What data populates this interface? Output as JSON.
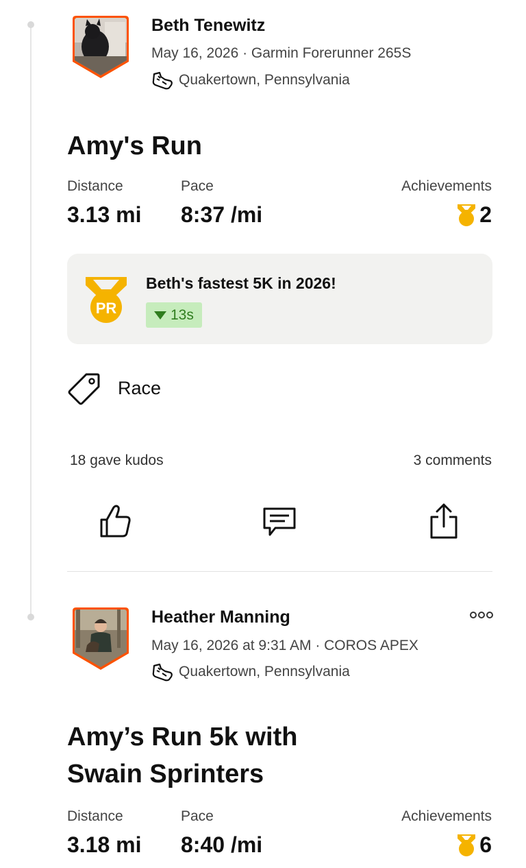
{
  "feed": {
    "activities": [
      {
        "athlete": "Beth Tenewitz",
        "meta": "May 16, 2026 · Garmin Forerunner 265S",
        "location": "Quakertown, Pennsylvania",
        "title": "Amy's Run",
        "stats": {
          "distance_label": "Distance",
          "distance_value": "3.13 mi",
          "pace_label": "Pace",
          "pace_value": "8:37 /mi",
          "achievements_label": "Achievements",
          "achievements_count": "2"
        },
        "pr": {
          "badge": "PR",
          "text": "Beth's fastest 5K in 2026!",
          "delta": "13s"
        },
        "tag": "Race",
        "kudos": "18 gave kudos",
        "comments": "3 comments"
      },
      {
        "athlete": "Heather Manning",
        "meta": "May 16, 2026 at 9:31 AM · COROS APEX",
        "location": "Quakertown, Pennsylvania",
        "title_line1": "Amy’s Run 5k with",
        "title_line2": "Swain Sprinters",
        "stats": {
          "distance_label": "Distance",
          "distance_value": "3.18 mi",
          "pace_label": "Pace",
          "pace_value": "8:40 /mi",
          "achievements_label": "Achievements",
          "achievements_count": "6"
        }
      }
    ]
  },
  "colors": {
    "brand_orange": "#fc5200",
    "medal_gold": "#f5b300",
    "pr_green": "#2f7d1e",
    "pr_green_bg": "#c6ecbc"
  },
  "icons": {
    "avatar_frame": "hexagon-shield",
    "shoe": "running-shoe-icon",
    "medal": "medal-icon",
    "tag": "tag-icon",
    "kudos": "thumbs-up-icon",
    "comment": "comment-icon",
    "share": "share-icon",
    "more": "more-options-icon"
  }
}
